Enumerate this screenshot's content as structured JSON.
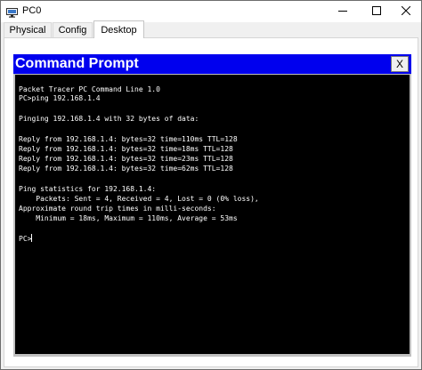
{
  "window": {
    "title": "PC0",
    "controls": [
      "minimize-icon",
      "maximize-icon",
      "close-icon"
    ]
  },
  "tabs": [
    {
      "label": "Physical",
      "active": false
    },
    {
      "label": "Config",
      "active": false
    },
    {
      "label": "Desktop",
      "active": true
    }
  ],
  "command_prompt": {
    "title": "Command Prompt",
    "close_label": "X",
    "lines": [
      "Packet Tracer PC Command Line 1.0",
      "PC>ping 192.168.1.4",
      "",
      "Pinging 192.168.1.4 with 32 bytes of data:",
      "",
      "Reply from 192.168.1.4: bytes=32 time=110ms TTL=128",
      "Reply from 192.168.1.4: bytes=32 time=18ms TTL=128",
      "Reply from 192.168.1.4: bytes=32 time=23ms TTL=128",
      "Reply from 192.168.1.4: bytes=32 time=62ms TTL=128",
      "",
      "Ping statistics for 192.168.1.4:",
      "    Packets: Sent = 4, Received = 4, Lost = 0 (0% loss),",
      "Approximate round trip times in milli-seconds:",
      "    Minimum = 18ms, Maximum = 110ms, Average = 53ms",
      "",
      "PC>"
    ]
  },
  "colors": {
    "cmd_header": "#0000ee",
    "terminal_bg": "#000000",
    "terminal_text": "#ffffff"
  }
}
